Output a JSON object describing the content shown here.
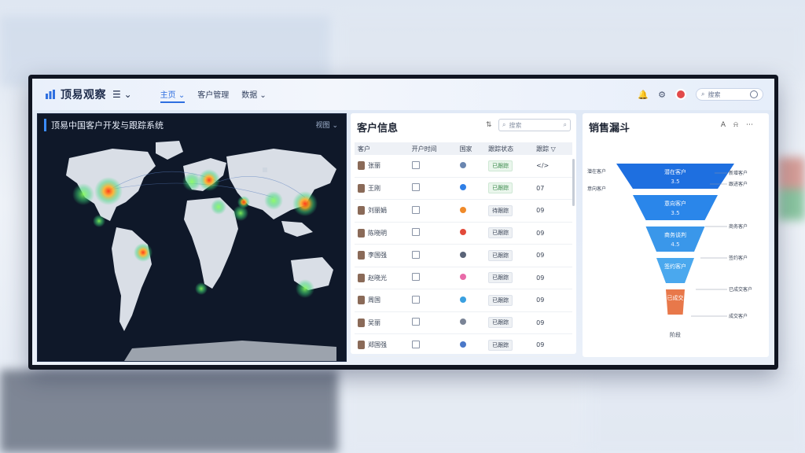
{
  "app": {
    "brand": "顶易观察",
    "menu_icon": "menu-icon",
    "nav": [
      {
        "label": "主页 ⌄",
        "active": true
      },
      {
        "label": "客户管理"
      },
      {
        "label": "数据 ⌄"
      }
    ],
    "search_placeholder": "搜索"
  },
  "map_panel": {
    "title": "顶易中国客户开发与跟踪系统",
    "dropdown": "视图 ⌄"
  },
  "customer_panel": {
    "title": "客户信息",
    "search_placeholder": "搜索",
    "columns": [
      "客户",
      "开户时间",
      "国家",
      "跟踪状态",
      "跟踪 ▽"
    ],
    "rows": [
      {
        "name": "张丽",
        "status_color": "#6a86b0",
        "tag": "已跟踪",
        "tag_style": "green",
        "trail": "</>"
      },
      {
        "name": "王刚",
        "status_color": "#2f7fe6",
        "tag": "已跟踪",
        "tag_style": "green",
        "trail": "07"
      },
      {
        "name": "刘丽娟",
        "status_color": "#f08a2a",
        "tag": "待跟踪",
        "tag_style": "",
        "trail": "09"
      },
      {
        "name": "陈晓明",
        "status_color": "#e24a3a",
        "tag": "已跟踪",
        "tag_style": "",
        "trail": "09"
      },
      {
        "name": "李国强",
        "status_color": "#5a6478",
        "tag": "已跟踪",
        "tag_style": "",
        "trail": "09"
      },
      {
        "name": "赵晓光",
        "status_color": "#e86aa8",
        "tag": "已跟踪",
        "tag_style": "",
        "trail": "09"
      },
      {
        "name": "周国",
        "status_color": "#3aa0e0",
        "tag": "已跟踪",
        "tag_style": "",
        "trail": "09"
      },
      {
        "name": "吴丽",
        "status_color": "#7a8496",
        "tag": "已跟踪",
        "tag_style": "",
        "trail": "09"
      },
      {
        "name": "郑国强",
        "status_color": "#4a78c8",
        "tag": "已跟踪",
        "tag_style": "",
        "trail": "09"
      }
    ]
  },
  "funnel_panel": {
    "title": "销售漏斗",
    "footer": "阶段"
  },
  "chart_data": {
    "type": "funnel",
    "title": "销售漏斗",
    "stages": [
      {
        "label": "潜在客户",
        "value_label": "3.5",
        "relative_width": 1.0,
        "color": "#1e6fe0"
      },
      {
        "label": "意向客户",
        "value_label": "3.5",
        "relative_width": 0.72,
        "color": "#2a86ea"
      },
      {
        "label": "商务谈判",
        "value_label": "4.5",
        "relative_width": 0.5,
        "color": "#3a97ea"
      },
      {
        "label": "签约客户",
        "value_label": "",
        "relative_width": 0.32,
        "color": "#4aa8ee"
      },
      {
        "label": "已成交",
        "value_label": "",
        "relative_width": 0.16,
        "color": "#e8784a"
      }
    ],
    "side_labels_left": [
      "潜在客户",
      "意向客户"
    ],
    "side_labels_right": [
      "新增客户",
      "跟进客户",
      "商务客户",
      "签约客户",
      "已成交客户",
      "成交客户"
    ]
  },
  "colors": {
    "accent": "#2f6fe0",
    "map_bg": "#0f1829"
  }
}
